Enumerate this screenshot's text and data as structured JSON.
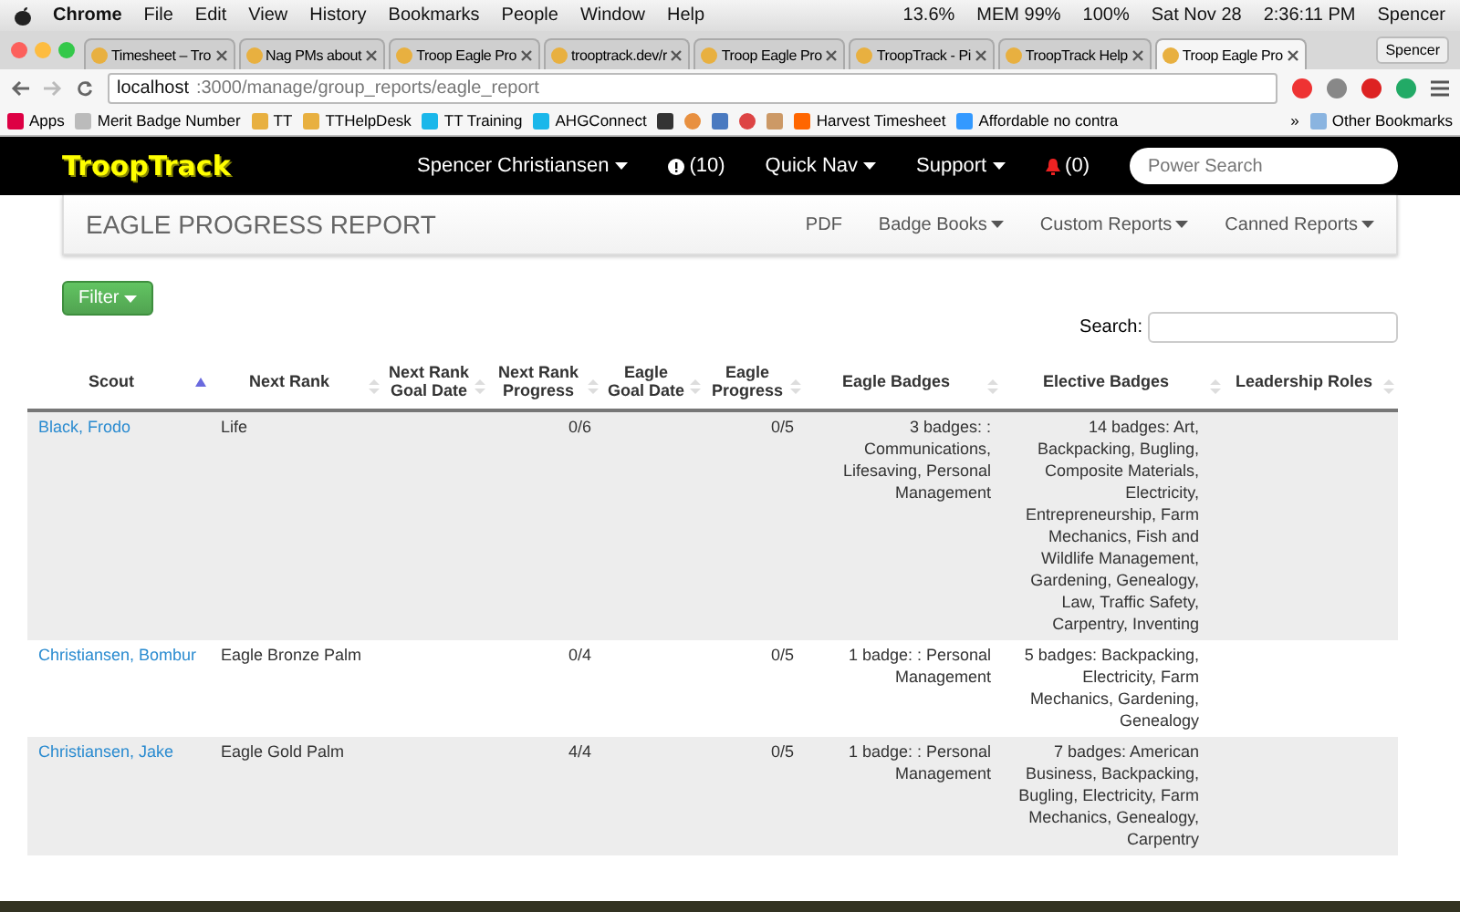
{
  "menu_bar": {
    "app": "Chrome",
    "items": [
      "File",
      "Edit",
      "View",
      "History",
      "Bookmarks",
      "People",
      "Window",
      "Help"
    ],
    "status": [
      "13.6%",
      "MEM 99%",
      "100%",
      "Sat Nov 28",
      "2:36:11 PM",
      "Spencer"
    ]
  },
  "tabs": [
    {
      "label": "Timesheet – Tro",
      "selected": false
    },
    {
      "label": "Nag PMs about",
      "selected": false
    },
    {
      "label": "Troop Eagle Pro",
      "selected": false
    },
    {
      "label": "trooptrack.dev/r",
      "selected": false
    },
    {
      "label": "Troop Eagle Pro",
      "selected": false
    },
    {
      "label": "TroopTrack - Pi",
      "selected": false
    },
    {
      "label": "TroopTrack Help",
      "selected": false
    },
    {
      "label": "Troop Eagle Pro",
      "selected": true
    }
  ],
  "profile": "Spencer",
  "address": {
    "host": "localhost",
    "path": ":3000/manage/group_reports/eagle_report"
  },
  "bookmarks": [
    "Apps",
    "Merit Badge Number",
    "TT",
    "TTHelpDesk",
    "TT Training",
    "AHGConnect",
    "Harvest Timesheet",
    "Affordable no contra"
  ],
  "other_bookmarks": "Other Bookmarks",
  "overflow": "»",
  "navbar": {
    "logo": "TroopTrack",
    "user": "Spencer Christiansen",
    "alerts": "(10)",
    "quick_nav": "Quick Nav",
    "support": "Support",
    "notifications": "(0)",
    "search_placeholder": "Power Search"
  },
  "report": {
    "title": "EAGLE PROGRESS REPORT",
    "links": [
      {
        "label": "PDF",
        "dropdown": false
      },
      {
        "label": "Badge Books",
        "dropdown": true
      },
      {
        "label": "Custom Reports",
        "dropdown": true
      },
      {
        "label": "Canned Reports",
        "dropdown": true
      }
    ]
  },
  "filter_button": "Filter",
  "search_label": "Search:",
  "table": {
    "columns": [
      {
        "label": "Scout",
        "sorted": true
      },
      {
        "label": "Next Rank",
        "sorted": false
      },
      {
        "label": "Next Rank Goal Date",
        "sorted": false
      },
      {
        "label": "Next Rank Progress",
        "sorted": false
      },
      {
        "label": "Eagle Goal Date",
        "sorted": false
      },
      {
        "label": "Eagle Progress",
        "sorted": false
      },
      {
        "label": "Eagle Badges",
        "sorted": false
      },
      {
        "label": "Elective Badges",
        "sorted": false
      },
      {
        "label": "Leadership Roles",
        "sorted": false
      }
    ],
    "rows": [
      {
        "scout": "Black, Frodo",
        "next_rank": "Life",
        "next_rank_progress": "0/6",
        "eagle_progress": "0/5",
        "eagle_badges": "3 badges: : Communications, Lifesaving, Personal Management",
        "elective_badges": "14 badges: Art, Backpacking, Bugling, Composite Materials, Electricity, Entrepreneurship, Farm Mechanics, Fish and Wildlife Management, Gardening, Genealogy, Law, Traffic Safety, Carpentry, Inventing"
      },
      {
        "scout": "Christiansen, Bombur",
        "next_rank": "Eagle Bronze Palm",
        "next_rank_progress": "0/4",
        "eagle_progress": "0/5",
        "eagle_badges": "1 badge: : Personal Management",
        "elective_badges": "5 badges: Backpacking, Electricity, Farm Mechanics, Gardening, Genealogy"
      },
      {
        "scout": "Christiansen, Jake",
        "next_rank": "Eagle Gold Palm",
        "next_rank_progress": "4/4",
        "eagle_progress": "0/5",
        "eagle_badges": "1 badge: : Personal Management",
        "elective_badges": "7 badges: American Business, Backpacking, Bugling, Electricity, Farm Mechanics, Genealogy, Carpentry"
      }
    ]
  }
}
